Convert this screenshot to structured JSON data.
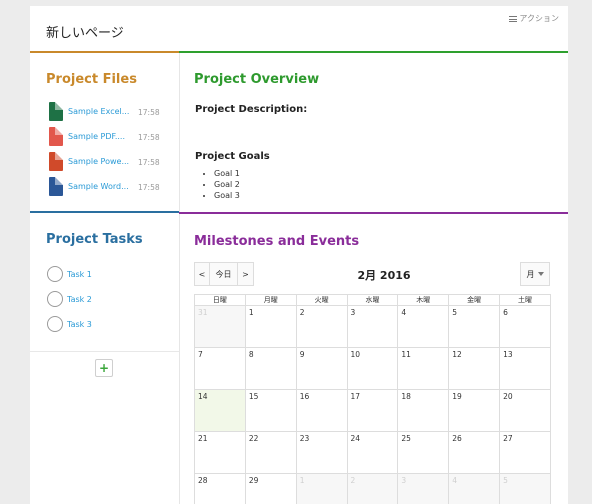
{
  "page": {
    "title": "新しいページ",
    "action_label": "アクション"
  },
  "files": {
    "title": "Project Files",
    "items": [
      {
        "name": "Sample Excel...",
        "time": "17:58",
        "icon": "excel-file-icon",
        "color": "#1e7145"
      },
      {
        "name": "Sample PDF....",
        "time": "17:58",
        "icon": "pdf-file-icon",
        "color": "#e2574c"
      },
      {
        "name": "Sample Powe...",
        "time": "17:58",
        "icon": "powerpoint-file-icon",
        "color": "#d04a2a"
      },
      {
        "name": "Sample Word...",
        "time": "17:58",
        "icon": "word-file-icon",
        "color": "#2b5797"
      }
    ]
  },
  "overview": {
    "title": "Project Overview",
    "description_label": "Project Description:",
    "goals_label": "Project Goals",
    "goals": [
      "Goal 1",
      "Goal 2",
      "Goal 3"
    ]
  },
  "tasks": {
    "title": "Project Tasks",
    "items": [
      "Task 1",
      "Task 2",
      "Task 3"
    ],
    "add_label": "+"
  },
  "milestones": {
    "title": "Milestones and Events",
    "prev_label": "<",
    "today_label": "今日",
    "next_label": ">",
    "month_title": "2月 2016",
    "view_label": "月",
    "weekdays": [
      "日曜",
      "月曜",
      "火曜",
      "水曜",
      "木曜",
      "金曜",
      "土曜"
    ],
    "weeks": [
      [
        {
          "d": "31",
          "o": true
        },
        {
          "d": "1"
        },
        {
          "d": "2"
        },
        {
          "d": "3"
        },
        {
          "d": "4"
        },
        {
          "d": "5"
        },
        {
          "d": "6"
        }
      ],
      [
        {
          "d": "7"
        },
        {
          "d": "8"
        },
        {
          "d": "9"
        },
        {
          "d": "10"
        },
        {
          "d": "11"
        },
        {
          "d": "12"
        },
        {
          "d": "13"
        }
      ],
      [
        {
          "d": "14",
          "t": true
        },
        {
          "d": "15"
        },
        {
          "d": "16"
        },
        {
          "d": "17"
        },
        {
          "d": "18"
        },
        {
          "d": "19"
        },
        {
          "d": "20"
        }
      ],
      [
        {
          "d": "21"
        },
        {
          "d": "22"
        },
        {
          "d": "23"
        },
        {
          "d": "24"
        },
        {
          "d": "25"
        },
        {
          "d": "26"
        },
        {
          "d": "27"
        }
      ],
      [
        {
          "d": "28"
        },
        {
          "d": "29"
        },
        {
          "d": "1",
          "o": true
        },
        {
          "d": "2",
          "o": true
        },
        {
          "d": "3",
          "o": true
        },
        {
          "d": "4",
          "o": true
        },
        {
          "d": "5",
          "o": true
        }
      ]
    ]
  }
}
